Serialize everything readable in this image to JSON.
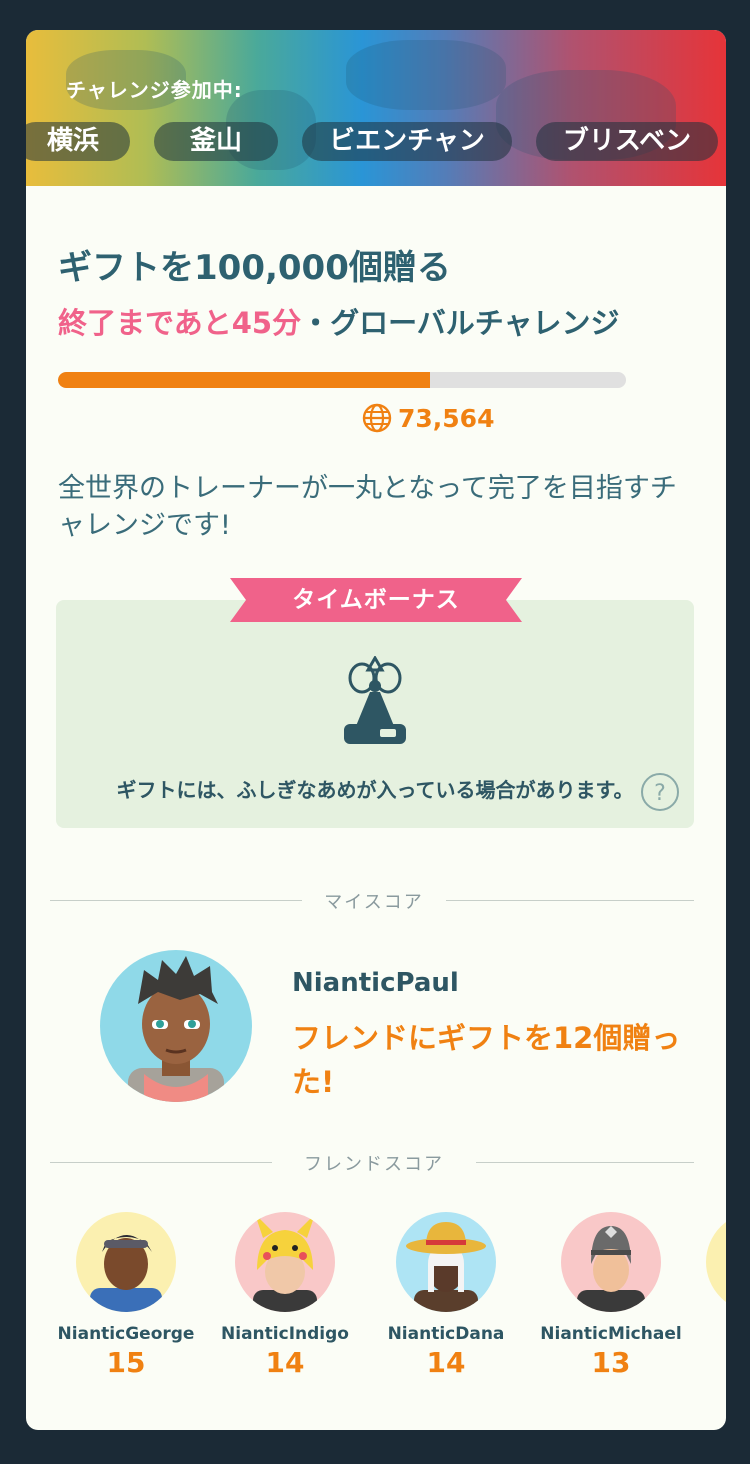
{
  "banner": {
    "title": "チャレンジ参加中:",
    "cities": [
      "横浜",
      "釜山",
      "ビエンチャン",
      "ブリスベン"
    ]
  },
  "challenge": {
    "title": "ギフトを100,000個贈る",
    "time_remaining": "終了まであと45分",
    "type": "・グローバルチャレンジ",
    "progress_fraction": 0.655,
    "count": "73,564",
    "description": "全世界のトレーナーが一丸となって完了を目指すチャレンジです!"
  },
  "bonus": {
    "label": "タイムボーナス",
    "text": "ギフトには、ふしぎなあめが入っている場合があります。",
    "help_symbol": "?"
  },
  "my_score": {
    "label": "マイスコア",
    "name": "NianticPaul",
    "text": "フレンドにギフトを12個贈った!"
  },
  "friend_score": {
    "label": "フレンドスコア",
    "friends": [
      {
        "name": "NianticGeorge",
        "score": "15"
      },
      {
        "name": "NianticIndigo",
        "score": "14"
      },
      {
        "name": "NianticDana",
        "score": "14"
      },
      {
        "name": "NianticMichael",
        "score": "13"
      }
    ]
  },
  "colors": {
    "accent_orange": "#f08112",
    "accent_pink": "#f0628a",
    "text_teal": "#2e6170",
    "bonus_bg": "#e5f1df"
  }
}
